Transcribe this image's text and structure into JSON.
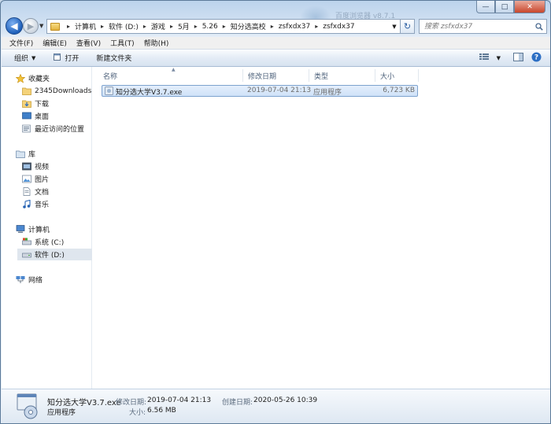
{
  "window": {
    "caption_minimize": "—",
    "caption_maximize": "□",
    "caption_close": "✕",
    "background_glass_text": "百度浏览器 v8.7.1"
  },
  "nav": {
    "back_glyph": "◀",
    "forward_glyph": "▶",
    "refresh_glyph": "↻",
    "breadcrumbs": [
      "计算机",
      "软件 (D:)",
      "游戏",
      "5月",
      "5.26",
      "知分选高校",
      "zsfxdx37",
      "zsfxdx37"
    ],
    "search_placeholder": "搜索 zsfxdx37"
  },
  "menu": [
    "文件(F)",
    "编辑(E)",
    "查看(V)",
    "工具(T)",
    "帮助(H)"
  ],
  "toolbar": {
    "organize": "组织",
    "open": "打开",
    "new_folder": "新建文件夹"
  },
  "sidebar": {
    "favorites_header": "收藏夹",
    "favorites": [
      "2345Downloads",
      "下载",
      "桌面",
      "最近访问的位置"
    ],
    "libraries_header": "库",
    "libraries": [
      "视频",
      "图片",
      "文档",
      "音乐"
    ],
    "computer_header": "计算机",
    "drives": [
      "系统 (C:)",
      "软件 (D:)"
    ],
    "network_header": "网络"
  },
  "columns": [
    "名称",
    "修改日期",
    "类型",
    "大小"
  ],
  "files": [
    {
      "name": "知分选大学V3.7.exe",
      "modified": "2019-07-04 21:13",
      "type": "应用程序",
      "size": "6,723 KB"
    }
  ],
  "details": {
    "name": "知分选大学V3.7.exe",
    "type": "应用程序",
    "modified_label": "修改日期:",
    "modified_value": "2019-07-04 21:13",
    "created_label": "创建日期:",
    "created_value": "2020-05-26 10:39",
    "size_label": "大小:",
    "size_value": "6.56 MB"
  },
  "colors": {
    "selection": "#cfe2f8",
    "selection_border": "#7da2ce",
    "accent": "#1d5fb9"
  }
}
